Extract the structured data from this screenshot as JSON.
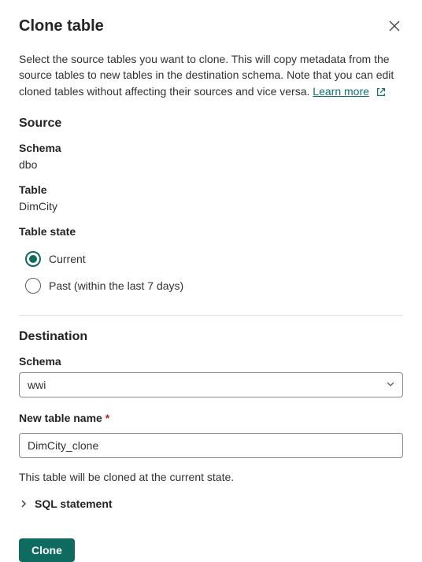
{
  "header": {
    "title": "Clone table"
  },
  "description": {
    "text": "Select the source tables you want to clone. This will copy metadata from the source tables to new tables in the destination schema. Note that you can edit cloned tables without affecting their sources and vice versa.",
    "learn_more": "Learn more"
  },
  "source": {
    "heading": "Source",
    "schema_label": "Schema",
    "schema_value": "dbo",
    "table_label": "Table",
    "table_value": "DimCity",
    "state_label": "Table state",
    "radio_current": "Current",
    "radio_past": "Past (within the last 7 days)",
    "selected": "current"
  },
  "destination": {
    "heading": "Destination",
    "schema_label": "Schema",
    "schema_value": "wwi",
    "name_label": "New table name",
    "name_value": "DimCity_clone"
  },
  "info_text": "This table will be cloned at the current state.",
  "expander_label": "SQL statement",
  "footer": {
    "clone_button": "Clone"
  }
}
